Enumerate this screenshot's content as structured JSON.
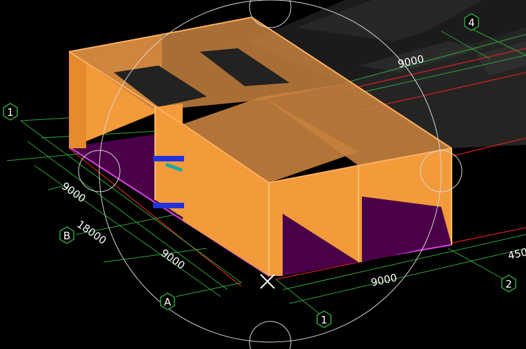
{
  "viewport": {
    "axis_labels": {
      "a1_left": "1",
      "b": "B",
      "a": "A",
      "a1_bottom": "1",
      "a2": "2",
      "a4": "4"
    },
    "dimensions": {
      "top_9000": "9000",
      "left_9000": "9000",
      "left_18000": "18000",
      "left_9000_lower": "9000",
      "front_9000": "9000",
      "right_450": "450"
    }
  },
  "colors": {
    "background": "#000000",
    "wall": "#f39a3a",
    "floor": "#4a0048",
    "grid": "#2fa83a",
    "axis_red": "#d21e1e",
    "orbit": "#d8d8d8",
    "beam_blue": "#2233dd"
  }
}
